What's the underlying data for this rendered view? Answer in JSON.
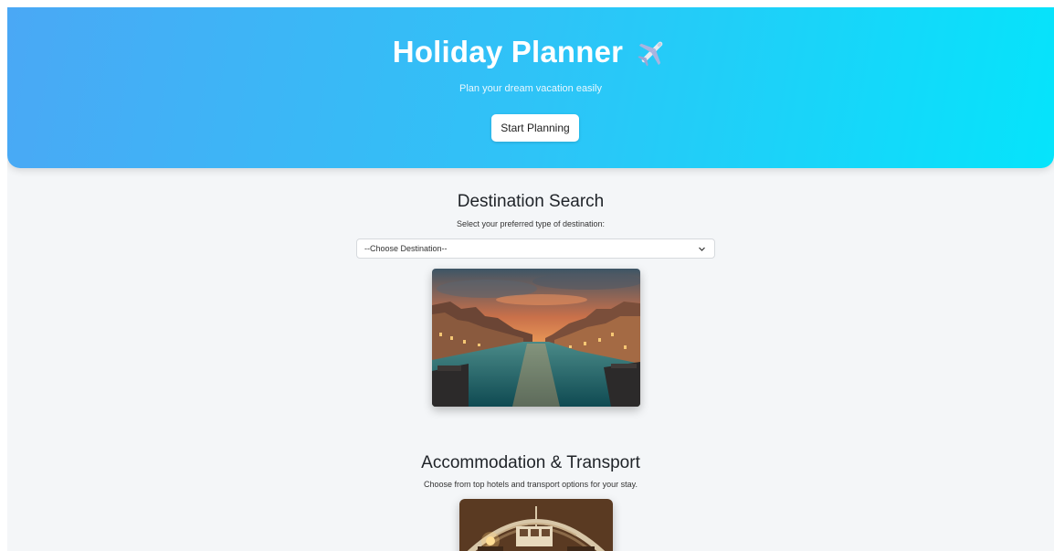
{
  "header": {
    "title": "Holiday Planner",
    "subtitle": "Plan your dream vacation easily",
    "cta_label": "Start Planning",
    "icon": "airplane-icon"
  },
  "destination": {
    "title": "Destination Search",
    "description": "Select your preferred type of destination:",
    "select_value": "--Choose Destination--",
    "image_subject": "venice-canal-sunset"
  },
  "accommodation": {
    "title": "Accommodation & Transport",
    "description": "Choose from top hotels and transport options for your stay.",
    "image_subject": "arched-interior"
  },
  "colors": {
    "hero_gradient_start": "#4aa8f5",
    "hero_gradient_end": "#05e4fb",
    "page_background": "#f4f6f8",
    "title_text": "#1f2328"
  }
}
